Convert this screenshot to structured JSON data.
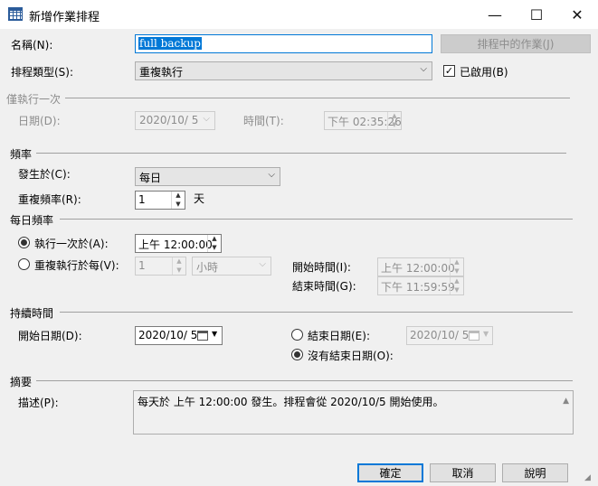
{
  "window": {
    "title": "新增作業排程",
    "minimize": "—",
    "maximize": "☐",
    "close": "✕"
  },
  "form": {
    "name_label": "名稱(N):",
    "name_value": "full backup",
    "jobs_in_schedule": "排程中的作業(J)",
    "schedule_type_label": "排程類型(S):",
    "schedule_type_value": "重複執行",
    "enabled_label": "已啟用(B)",
    "enabled_checked": true
  },
  "one_time": {
    "section": "僅執行一次",
    "date_label": "日期(D):",
    "date_value": "2020/10/ 5",
    "time_label": "時間(T):",
    "time_value": "下午 02:35:26"
  },
  "frequency": {
    "section": "頻率",
    "occurs_label": "發生於(C):",
    "occurs_value": "每日",
    "recurs_label": "重複頻率(R):",
    "recurs_value": "1",
    "recurs_unit": "天"
  },
  "daily_frequency": {
    "section": "每日頻率",
    "once_label": "執行一次於(A):",
    "once_value": "上午 12:00:00",
    "every_label": "重複執行於每(V):",
    "every_value": "1",
    "every_unit": "小時",
    "start_time_label": "開始時間(I):",
    "start_time_value": "上午 12:00:00",
    "end_time_label": "結束時間(G):",
    "end_time_value": "下午 11:59:59",
    "selected": "once"
  },
  "duration": {
    "section": "持續時間",
    "start_date_label": "開始日期(D):",
    "start_date_value": "2020/10/ 5",
    "end_date_label": "結束日期(E):",
    "end_date_value": "2020/10/ 5",
    "no_end_label": "沒有結束日期(O):",
    "selected": "no_end"
  },
  "summary": {
    "section": "摘要",
    "description_label": "描述(P):",
    "description_value": "每天於 上午 12:00:00 發生。排程會從 2020/10/5 開始使用。"
  },
  "buttons": {
    "ok": "確定",
    "cancel": "取消",
    "help": "說明"
  },
  "colors": {
    "accent": "#0078d7",
    "background": "#f0f0f0",
    "disabled_text": "#8d8d8d"
  }
}
